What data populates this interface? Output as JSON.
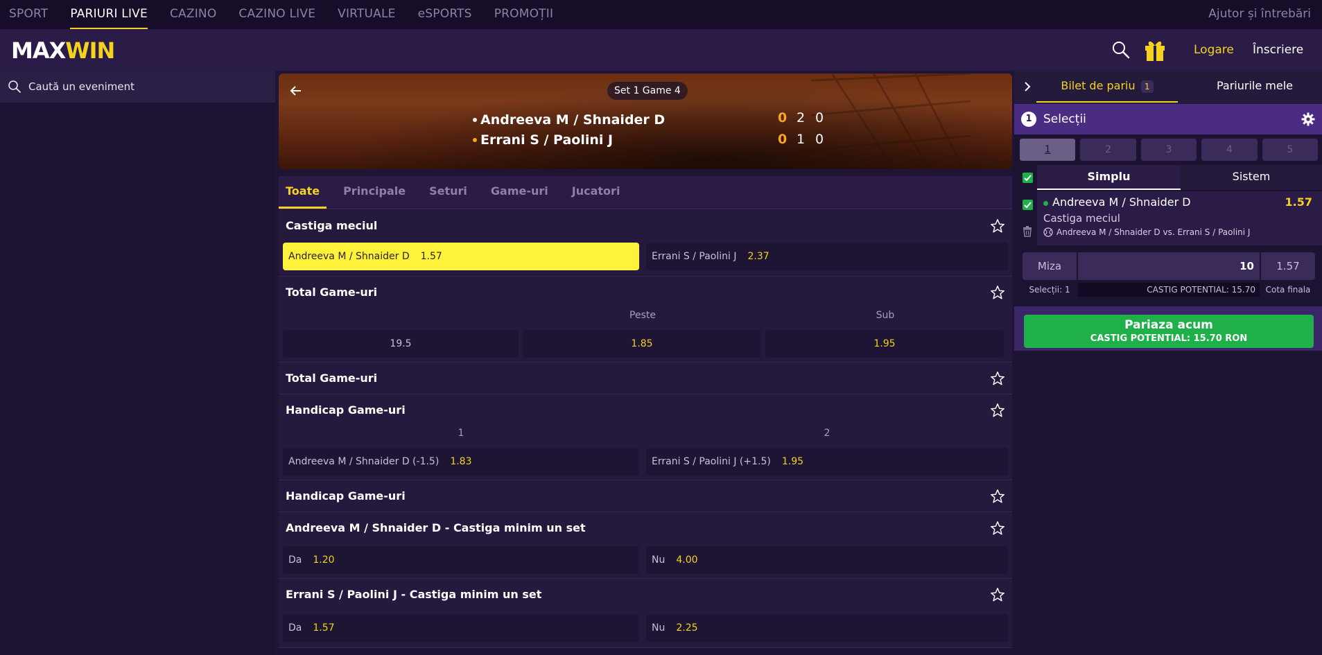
{
  "topnav": {
    "items": [
      "SPORT",
      "PARIURI LIVE",
      "CAZINO",
      "CAZINO LIVE",
      "VIRTUALE",
      "eSPORTS",
      "PROMOȚII"
    ],
    "help": "Ajutor și întrebări"
  },
  "header": {
    "logo_max": "MAX",
    "logo_win": "WIN",
    "login": "Logare",
    "register": "Înscriere"
  },
  "sidebar": {
    "search_placeholder": "Caută un eveniment"
  },
  "match": {
    "status": "Set 1 Game 4",
    "team1": "Andreeva M / Shnaider D",
    "team2": "Errani S / Paolini J",
    "team1_scores": [
      "0",
      "2",
      "0"
    ],
    "team2_scores": [
      "0",
      "1",
      "0"
    ]
  },
  "tabs": [
    "Toate",
    "Principale",
    "Seturi",
    "Game-uri",
    "Jucatori"
  ],
  "markets": {
    "m1": {
      "title": "Castiga meciul",
      "o1_label": "Andreeva M / Shnaider D",
      "o1_val": "1.57",
      "o2_label": "Errani S / Paolini J",
      "o2_val": "2.37"
    },
    "m2": {
      "title": "Total Game-uri",
      "h_over": "Peste",
      "h_under": "Sub",
      "line": "19.5",
      "over": "1.85",
      "under": "1.95"
    },
    "m3": {
      "title": "Total Game-uri"
    },
    "m4": {
      "title": "Handicap Game-uri",
      "h1": "1",
      "h2": "2",
      "o1_label": "Andreeva M / Shnaider D (-1.5)",
      "o1_val": "1.83",
      "o2_label": "Errani S / Paolini J (+1.5)",
      "o2_val": "1.95"
    },
    "m5": {
      "title": "Handicap Game-uri"
    },
    "m6": {
      "title": "Andreeva M / Shnaider D - Castiga minim un set",
      "o1_label": "Da",
      "o1_val": "1.20",
      "o2_label": "Nu",
      "o2_val": "4.00"
    },
    "m7": {
      "title": "Errani S / Paolini J - Castiga minim un set",
      "o1_label": "Da",
      "o1_val": "1.57",
      "o2_label": "Nu",
      "o2_val": "2.25"
    }
  },
  "betslip": {
    "tab_ticket": "Bilet de pariu",
    "tab_ticket_count": "1",
    "tab_mybets": "Pariurile mele",
    "sel_count": "1",
    "sel_label": "Selecții",
    "nums": [
      "1",
      "2",
      "3",
      "4",
      "5"
    ],
    "type_single": "Simplu",
    "type_system": "Sistem",
    "bet_selection": "Andreeva M / Shnaider D",
    "bet_odd": "1.57",
    "bet_market": "Castiga meciul",
    "bet_match": "Andreeva M / Shnaider D vs. Errani S / Paolini J",
    "stake_label": "Miza",
    "stake_value": "10",
    "final_odd": "1.57",
    "info_selections": "Selecții: 1",
    "info_potential": "CASTIG POTENTIAL: 15.70",
    "info_final": "Cota finala",
    "place_label": "Pariaza acum",
    "place_potential": "CASTIG POTENTIAL:  15.70 RON"
  },
  "colors": {
    "accent": "#f5d21f",
    "selected_odd": "#fff23a",
    "success": "#1fb04a",
    "background": "#1f1434"
  },
  "icons": [
    "search-icon",
    "gift-icon",
    "arrow-left-icon",
    "star-icon",
    "chevron-right-icon",
    "gear-icon",
    "trash-icon",
    "tennis-ball-icon",
    "check-icon"
  ]
}
